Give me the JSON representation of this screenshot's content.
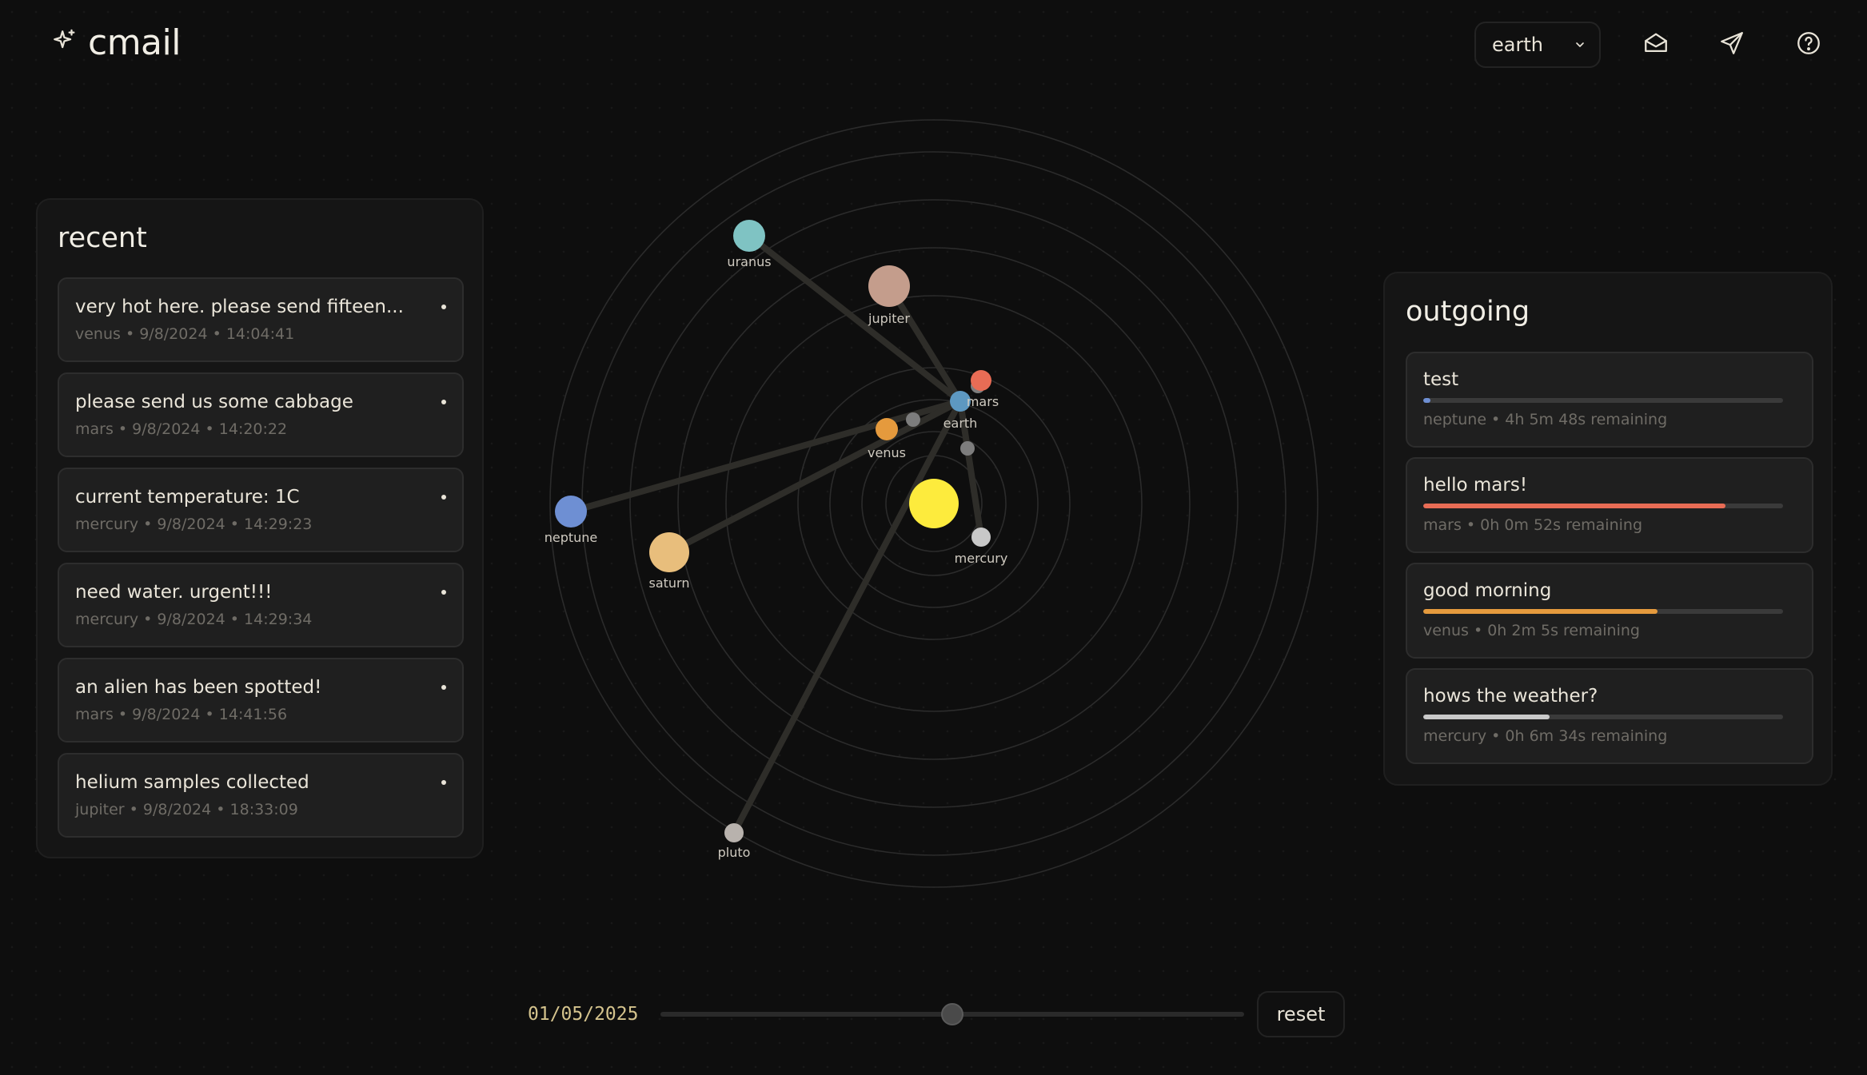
{
  "app": {
    "title": "cmail",
    "logo_icon": "sparkle-icon"
  },
  "topbar": {
    "planet_select": {
      "value": "earth",
      "icon": "chevron-down-icon"
    },
    "inbox_icon": "mail-open-icon",
    "send_icon": "send-icon",
    "help_icon": "help-circle-icon"
  },
  "recent": {
    "title": "recent",
    "items": [
      {
        "message": "very hot here. please send fifteen...",
        "meta": "venus • 9/8/2024 • 14:04:41"
      },
      {
        "message": "please send us some cabbage",
        "meta": "mars • 9/8/2024 • 14:20:22"
      },
      {
        "message": "current temperature: 1C",
        "meta": "mercury • 9/8/2024 • 14:29:23"
      },
      {
        "message": "need water. urgent!!!",
        "meta": "mercury • 9/8/2024 • 14:29:34"
      },
      {
        "message": "an alien has been spotted!",
        "meta": "mars • 9/8/2024 • 14:41:56"
      },
      {
        "message": "helium samples collected",
        "meta": "jupiter • 9/8/2024 • 18:33:09"
      }
    ]
  },
  "outgoing": {
    "title": "outgoing",
    "items": [
      {
        "message": "test",
        "meta": "neptune • 4h 5m 48s remaining",
        "progress": 0.02,
        "color": "#6e8fd3"
      },
      {
        "message": "hello mars!",
        "meta": "mars • 0h 0m 52s remaining",
        "progress": 0.84,
        "color": "#e86c55"
      },
      {
        "message": "good morning",
        "meta": "venus • 0h 2m 5s remaining",
        "progress": 0.65,
        "color": "#e59a3d"
      },
      {
        "message": "hows the weather?",
        "meta": "mercury • 0h 6m 34s remaining",
        "progress": 0.35,
        "color": "#c9c9c9"
      }
    ]
  },
  "map": {
    "sun_color": "#fdeb3d",
    "planets": [
      {
        "name": "mercury",
        "color": "#c8c8c8"
      },
      {
        "name": "venus",
        "color": "#e59a3d"
      },
      {
        "name": "earth",
        "color": "#5d98c1"
      },
      {
        "name": "mars",
        "color": "#e86c55"
      },
      {
        "name": "jupiter",
        "color": "#c49d8c"
      },
      {
        "name": "saturn",
        "color": "#e8be7c"
      },
      {
        "name": "uranus",
        "color": "#7fc3c3"
      },
      {
        "name": "neptune",
        "color": "#6e8fd3"
      },
      {
        "name": "pluto",
        "color": "#b8b2ad"
      }
    ]
  },
  "timeline": {
    "date": "01/05/2025",
    "position": 0.5,
    "reset_label": "reset"
  }
}
